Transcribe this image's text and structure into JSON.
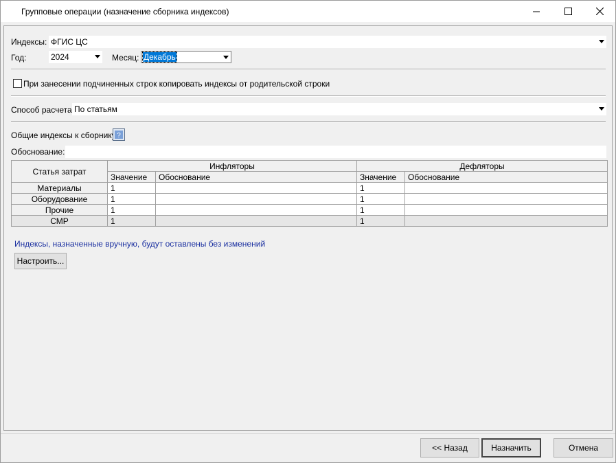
{
  "window": {
    "title": "Групповые операции (назначение сборника индексов)"
  },
  "form": {
    "indexes_label": "Индексы:",
    "indexes_value": "ФГИС ЦС",
    "year_label": "Год:",
    "year_value": "2024",
    "month_label": "Месяц:",
    "month_value": "Декабрь",
    "copy_checkbox_label": "При занесении подчиненных строк копировать индексы от родительской строки",
    "copy_checkbox_checked": false,
    "calc_method_label": "Способ расчета:",
    "calc_method_value": "По статьям",
    "common_indexes_label": "Общие индексы к сборнику",
    "justification_label": "Обоснование:",
    "justification_value": ""
  },
  "grid": {
    "row_header_title": "Статья затрат",
    "group_inflators": "Инфляторы",
    "group_deflators": "Дефляторы",
    "col_value": "Значение",
    "col_justification": "Обоснование",
    "rows": [
      {
        "name": "Материалы",
        "infl_value": "1",
        "infl_just": "",
        "defl_value": "1",
        "defl_just": "",
        "readonly": false
      },
      {
        "name": "Оборудование",
        "infl_value": "1",
        "infl_just": "",
        "defl_value": "1",
        "defl_just": "",
        "readonly": false
      },
      {
        "name": "Прочие",
        "infl_value": "1",
        "infl_just": "",
        "defl_value": "1",
        "defl_just": "",
        "readonly": false
      },
      {
        "name": "СМР",
        "infl_value": "1",
        "infl_just": "",
        "defl_value": "1",
        "defl_just": "",
        "readonly": true
      }
    ]
  },
  "note": "Индексы, назначенные вручную, будут оставлены без изменений",
  "buttons": {
    "configure": "Настроить...",
    "back": "<< Назад",
    "assign": "Назначить",
    "cancel": "Отмена"
  },
  "colors": {
    "note_text": "#1a2fa0",
    "selection": "#0078d7"
  }
}
